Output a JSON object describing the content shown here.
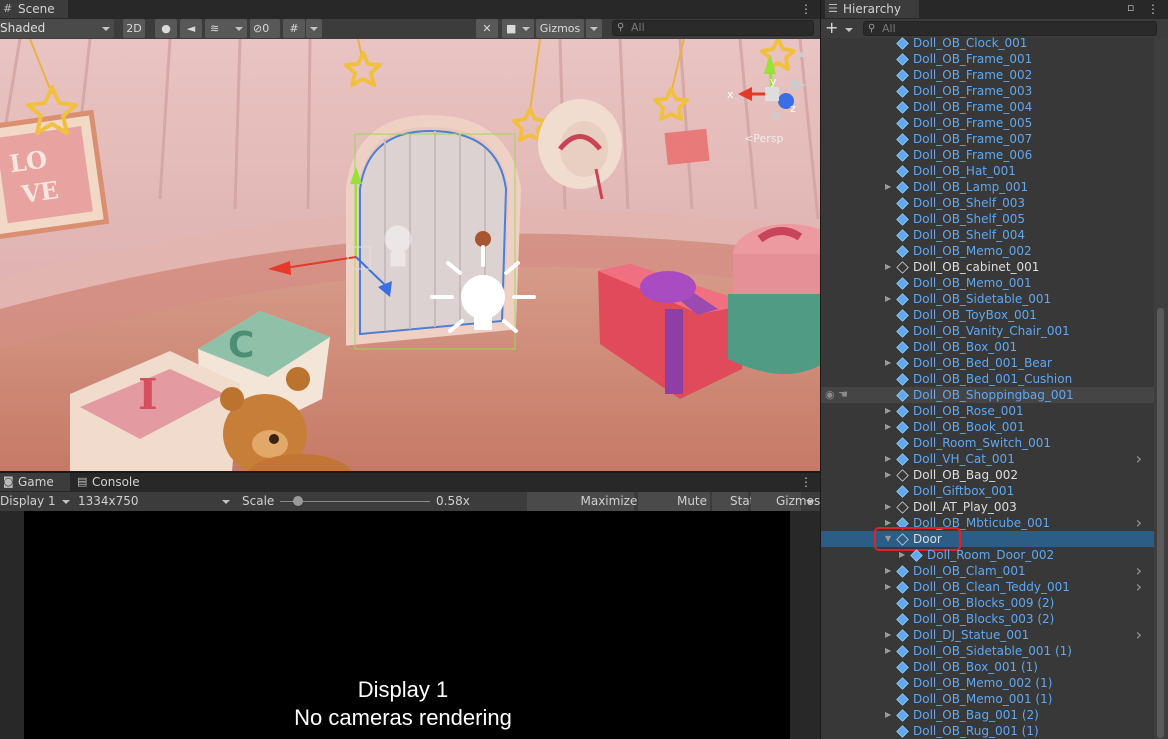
{
  "scene": {
    "tab": "Scene",
    "shading": "Shaded",
    "btn_2d": "2D",
    "hidden_count": "0",
    "gizmos": "Gizmos",
    "search_placeholder": "All",
    "persp_label": "Persp",
    "axis_x": "x",
    "axis_y": "y",
    "axis_z": "z"
  },
  "game": {
    "tab_game": "Game",
    "tab_console": "Console",
    "display": "Display 1",
    "resolution": "1334x750",
    "scale_label": "Scale",
    "scale_value": "0.58x",
    "scale_fraction": 0.12,
    "maximize": "Maximize On Play",
    "mute": "Mute Audio",
    "stats": "Stats",
    "gizmos": "Gizmos",
    "message_line1": "Display 1",
    "message_line2": "No cameras rendering"
  },
  "hierarchy": {
    "tab": "Hierarchy",
    "add": "+",
    "search_placeholder": "All",
    "items": [
      {
        "label": "Doll_OB_Clock_001",
        "color": "blue",
        "arrow": false,
        "icon": "prefab"
      },
      {
        "label": "Doll_OB_Frame_001",
        "color": "blue",
        "arrow": false,
        "icon": "prefab"
      },
      {
        "label": "Doll_OB_Frame_002",
        "color": "blue",
        "arrow": false,
        "icon": "prefab"
      },
      {
        "label": "Doll_OB_Frame_003",
        "color": "blue",
        "arrow": false,
        "icon": "prefab"
      },
      {
        "label": "Doll_OB_Frame_004",
        "color": "blue",
        "arrow": false,
        "icon": "prefab"
      },
      {
        "label": "Doll_OB_Frame_005",
        "color": "blue",
        "arrow": false,
        "icon": "prefab"
      },
      {
        "label": "Doll_OB_Frame_007",
        "color": "blue",
        "arrow": false,
        "icon": "prefab"
      },
      {
        "label": "Doll_OB_Frame_006",
        "color": "blue",
        "arrow": false,
        "icon": "prefab"
      },
      {
        "label": "Doll_OB_Hat_001",
        "color": "blue",
        "arrow": false,
        "icon": "prefab"
      },
      {
        "label": "Doll_OB_Lamp_001",
        "color": "blue",
        "arrow": true,
        "icon": "prefab"
      },
      {
        "label": "Doll_OB_Shelf_003",
        "color": "blue",
        "arrow": false,
        "icon": "prefab"
      },
      {
        "label": "Doll_OB_Shelf_005",
        "color": "blue",
        "arrow": false,
        "icon": "prefab"
      },
      {
        "label": "Doll_OB_Shelf_004",
        "color": "blue",
        "arrow": false,
        "icon": "prefab"
      },
      {
        "label": "Doll_OB_Memo_002",
        "color": "blue",
        "arrow": false,
        "icon": "prefab"
      },
      {
        "label": "Doll_OB_cabinet_001",
        "color": "white",
        "arrow": true,
        "icon": "object"
      },
      {
        "label": "Doll_OB_Memo_001",
        "color": "blue",
        "arrow": false,
        "icon": "prefab"
      },
      {
        "label": "Doll_OB_Sidetable_001",
        "color": "blue",
        "arrow": true,
        "icon": "prefab"
      },
      {
        "label": "Doll_OB_ToyBox_001",
        "color": "blue",
        "arrow": false,
        "icon": "prefab"
      },
      {
        "label": "Doll_OB_Vanity_Chair_001",
        "color": "blue",
        "arrow": false,
        "icon": "prefab"
      },
      {
        "label": "Doll_OB_Box_001",
        "color": "blue",
        "arrow": false,
        "icon": "prefab"
      },
      {
        "label": "Doll_OB_Bed_001_Bear",
        "color": "blue",
        "arrow": true,
        "icon": "prefab"
      },
      {
        "label": "Doll_OB_Bed_001_Cushion",
        "color": "blue",
        "arrow": false,
        "icon": "prefab"
      },
      {
        "label": "Doll_OB_Shoppingbag_001",
        "color": "blue",
        "arrow": false,
        "icon": "prefab",
        "hover": true
      },
      {
        "label": "Doll_OB_Rose_001",
        "color": "blue",
        "arrow": true,
        "icon": "prefab"
      },
      {
        "label": "Doll_OB_Book_001",
        "color": "blue",
        "arrow": true,
        "icon": "prefab"
      },
      {
        "label": "Doll_Room_Switch_001",
        "color": "blue",
        "arrow": false,
        "icon": "prefab"
      },
      {
        "label": "Doll_VH_Cat_001",
        "color": "blue",
        "arrow": true,
        "icon": "prefab",
        "more": true
      },
      {
        "label": "Doll_OB_Bag_002",
        "color": "white",
        "arrow": true,
        "icon": "object"
      },
      {
        "label": "Doll_Giftbox_001",
        "color": "blue",
        "arrow": false,
        "icon": "prefab"
      },
      {
        "label": "Doll_AT_Play_003",
        "color": "white",
        "arrow": true,
        "icon": "object"
      },
      {
        "label": "Doll_OB_Mbticube_001",
        "color": "blue",
        "arrow": true,
        "icon": "prefab",
        "more": true
      },
      {
        "label": "Door",
        "color": "white",
        "arrow": true,
        "expanded": true,
        "icon": "object",
        "selected": true,
        "highlight": true
      },
      {
        "label": "Doll_Room_Door_002",
        "color": "blue",
        "arrow": true,
        "icon": "prefab",
        "indent": true
      },
      {
        "label": "Doll_OB_Clam_001",
        "color": "blue",
        "arrow": true,
        "icon": "prefab",
        "more": true
      },
      {
        "label": "Doll_OB_Clean_Teddy_001",
        "color": "blue",
        "arrow": true,
        "icon": "prefab",
        "more": true
      },
      {
        "label": "Doll_OB_Blocks_009 (2)",
        "color": "blue",
        "arrow": false,
        "icon": "prefab"
      },
      {
        "label": "Doll_OB_Blocks_003 (2)",
        "color": "blue",
        "arrow": false,
        "icon": "prefab"
      },
      {
        "label": "Doll_DJ_Statue_001",
        "color": "blue",
        "arrow": true,
        "icon": "prefab",
        "more": true
      },
      {
        "label": "Doll_OB_Sidetable_001 (1)",
        "color": "blue",
        "arrow": true,
        "icon": "prefab"
      },
      {
        "label": "Doll_OB_Box_001 (1)",
        "color": "blue",
        "arrow": false,
        "icon": "prefab"
      },
      {
        "label": "Doll_OB_Memo_002 (1)",
        "color": "blue",
        "arrow": false,
        "icon": "prefab"
      },
      {
        "label": "Doll_OB_Memo_001 (1)",
        "color": "blue",
        "arrow": false,
        "icon": "prefab"
      },
      {
        "label": "Doll_OB_Bag_001 (2)",
        "color": "blue",
        "arrow": true,
        "icon": "prefab"
      },
      {
        "label": "Doll_OB_Rug_001 (1)",
        "color": "blue",
        "arrow": false,
        "icon": "prefab"
      }
    ]
  },
  "colors": {
    "prefab_blue": "#60a8ef",
    "selection": "#2c5d87",
    "highlight_red": "#e0202a"
  }
}
